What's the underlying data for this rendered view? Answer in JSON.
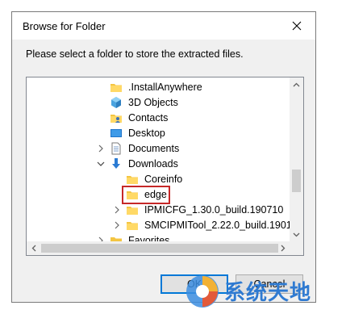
{
  "window": {
    "title": "Browse for Folder"
  },
  "prompt": "Please select a folder to store the extracted files.",
  "tree": {
    "items": [
      {
        "label": ".InstallAnywhere",
        "icon": "folder-icon",
        "expander": "none"
      },
      {
        "label": "3D Objects",
        "icon": "3d-objects-icon",
        "expander": "none"
      },
      {
        "label": "Contacts",
        "icon": "contacts-icon",
        "expander": "none"
      },
      {
        "label": "Desktop",
        "icon": "desktop-icon",
        "expander": "none"
      },
      {
        "label": "Documents",
        "icon": "documents-icon",
        "expander": "collapsed"
      },
      {
        "label": "Downloads",
        "icon": "downloads-icon",
        "expander": "expanded"
      },
      {
        "label": "Coreinfo",
        "icon": "folder-icon",
        "expander": "none"
      },
      {
        "label": "edge",
        "icon": "folder-icon",
        "expander": "none",
        "selected": true
      },
      {
        "label": "IPMICFG_1.30.0_build.190710",
        "icon": "folder-icon",
        "expander": "collapsed"
      },
      {
        "label": "SMCIPMITool_2.22.0_build.1901",
        "icon": "folder-icon",
        "expander": "collapsed"
      },
      {
        "label": "Favorites",
        "icon": "favorites-icon",
        "expander": "collapsed"
      }
    ]
  },
  "buttons": {
    "ok": "OK",
    "cancel": "Cancel"
  },
  "watermark": {
    "text": "系统天地"
  },
  "colors": {
    "highlight_box": "#c62828",
    "focus_border": "#0078d7",
    "watermark": "#2f7ad1"
  }
}
